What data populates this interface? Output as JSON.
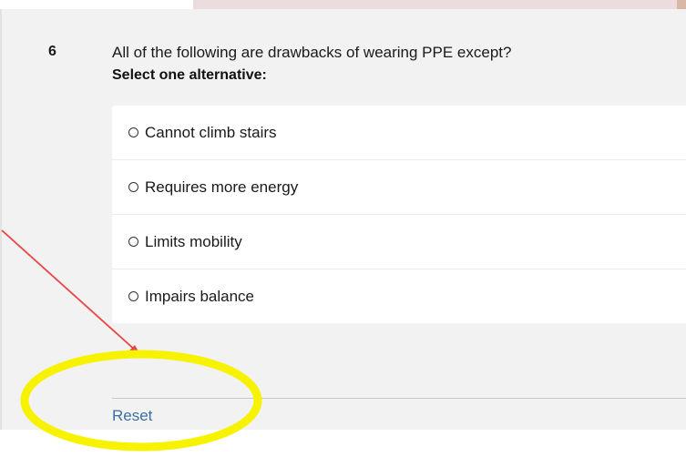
{
  "question": {
    "number": "6",
    "text": "All of the following are drawbacks of wearing PPE except?",
    "instruction": "Select one alternative:"
  },
  "options": [
    {
      "label": "Cannot climb stairs",
      "selected": false
    },
    {
      "label": "Requires more energy",
      "selected": false
    },
    {
      "label": "Limits mobility",
      "selected": false
    },
    {
      "label": "Impairs balance",
      "selected": false
    }
  ],
  "footer": {
    "reset_label": "Reset"
  },
  "annotation": {
    "arrow_icon": "arrow-icon",
    "highlight_icon": "ellipse-highlight-icon",
    "arrow_color": "#e8474a",
    "highlight_color": "#f7f300"
  },
  "colors": {
    "panel_bg": "#f2f2f2",
    "link": "#3b6fa5",
    "top_strip": "#ecdcde"
  }
}
